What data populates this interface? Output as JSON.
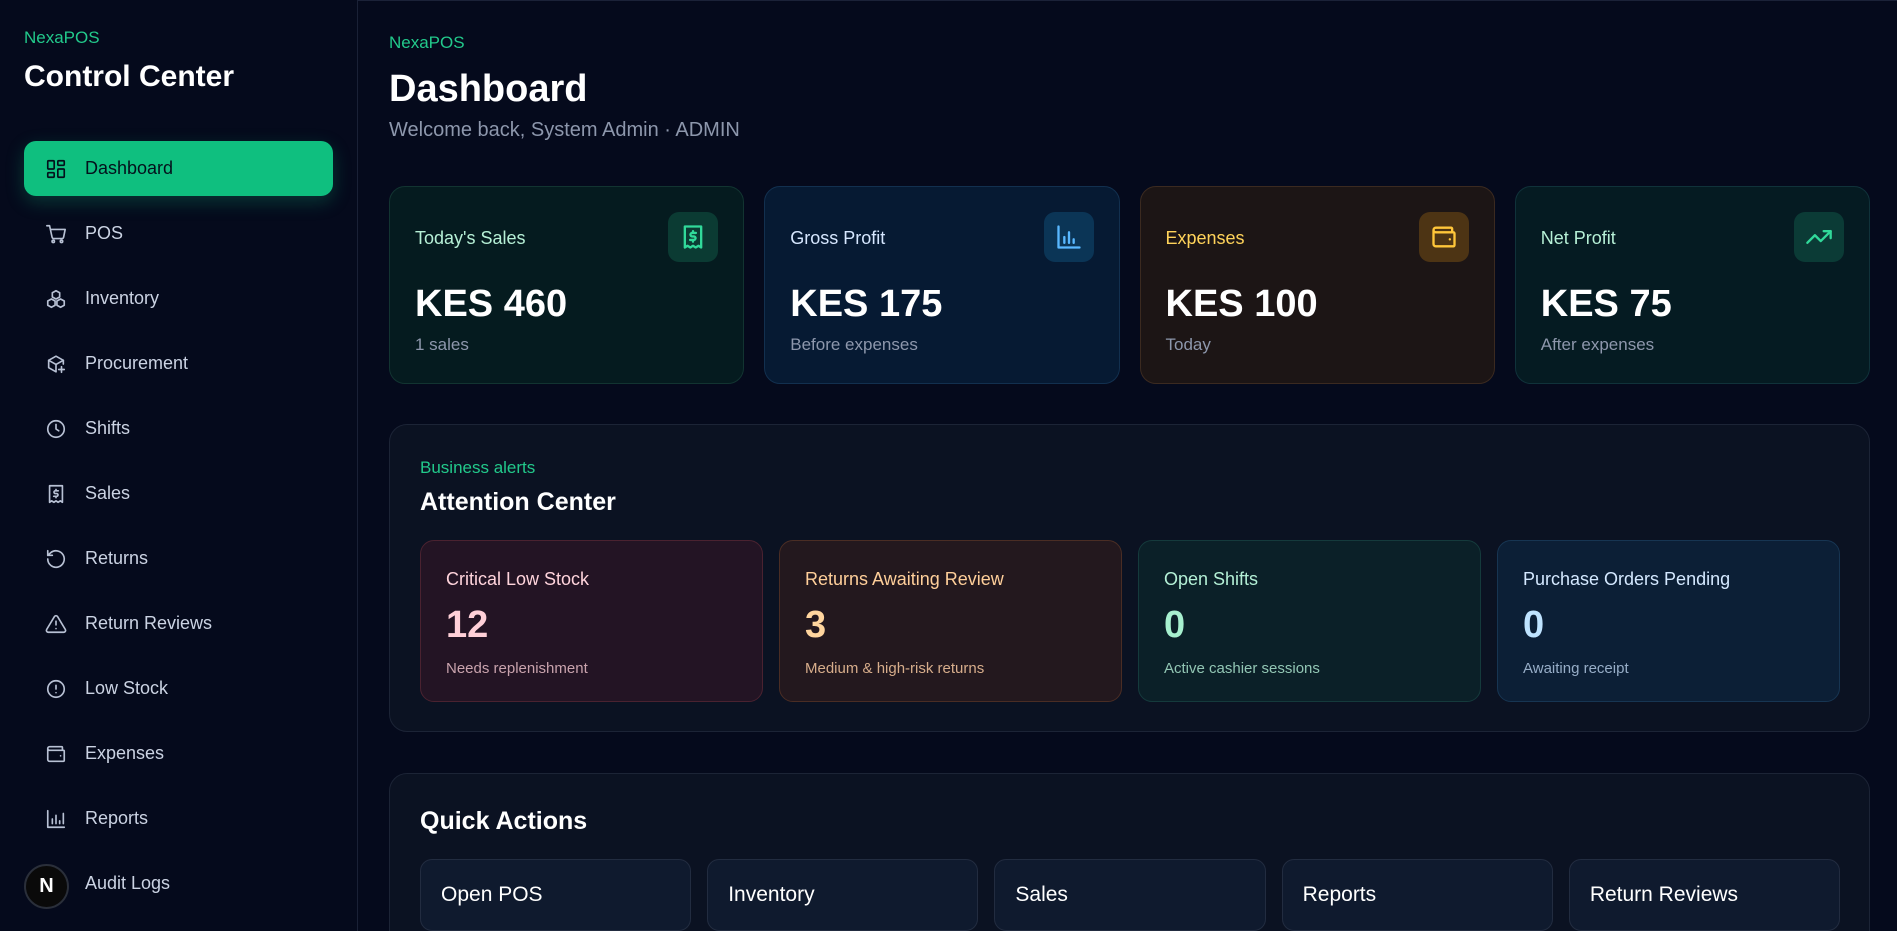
{
  "sidebar": {
    "brand": "NexaPOS",
    "title": "Control Center",
    "items": [
      {
        "label": "Dashboard",
        "icon": "dashboard-icon"
      },
      {
        "label": "POS",
        "icon": "cart-icon"
      },
      {
        "label": "Inventory",
        "icon": "boxes-icon"
      },
      {
        "label": "Procurement",
        "icon": "package-plus-icon"
      },
      {
        "label": "Shifts",
        "icon": "clock-icon"
      },
      {
        "label": "Sales",
        "icon": "receipt-icon"
      },
      {
        "label": "Returns",
        "icon": "rotate-ccw-icon"
      },
      {
        "label": "Return Reviews",
        "icon": "alert-triangle-icon"
      },
      {
        "label": "Low Stock",
        "icon": "alert-circle-icon"
      },
      {
        "label": "Expenses",
        "icon": "wallet-icon"
      },
      {
        "label": "Reports",
        "icon": "bar-chart-icon"
      },
      {
        "label": "Audit Logs",
        "icon": "log-icon"
      }
    ],
    "avatar_letter": "N"
  },
  "header": {
    "eyebrow": "NexaPOS",
    "title": "Dashboard",
    "subtitle": "Welcome back, System Admin · ADMIN"
  },
  "stats": [
    {
      "label": "Today's Sales",
      "value": "KES 460",
      "sub": "1 sales",
      "icon": "receipt-dollar-icon",
      "accent": "#31d99a"
    },
    {
      "label": "Gross Profit",
      "value": "KES 175",
      "sub": "Before expenses",
      "icon": "bar-chart-icon",
      "accent": "#59b8ff"
    },
    {
      "label": "Expenses",
      "value": "KES 100",
      "sub": "Today",
      "icon": "wallet-icon",
      "accent": "#ffc63a"
    },
    {
      "label": "Net Profit",
      "value": "KES 75",
      "sub": "After expenses",
      "icon": "trending-up-icon",
      "accent": "#31d99a"
    }
  ],
  "alerts": {
    "eyebrow": "Business alerts",
    "title": "Attention Center",
    "cards": [
      {
        "label": "Critical Low Stock",
        "value": "12",
        "sub": "Needs replenishment"
      },
      {
        "label": "Returns Awaiting Review",
        "value": "3",
        "sub": "Medium & high-risk returns"
      },
      {
        "label": "Open Shifts",
        "value": "0",
        "sub": "Active cashier sessions"
      },
      {
        "label": "Purchase Orders Pending",
        "value": "0",
        "sub": "Awaiting receipt"
      }
    ]
  },
  "quick_actions": {
    "title": "Quick Actions",
    "buttons": [
      "Open POS",
      "Inventory",
      "Sales",
      "Reports",
      "Return Reviews"
    ]
  },
  "colors": {
    "accent": "#0fbf7f",
    "background": "#050a1c"
  }
}
